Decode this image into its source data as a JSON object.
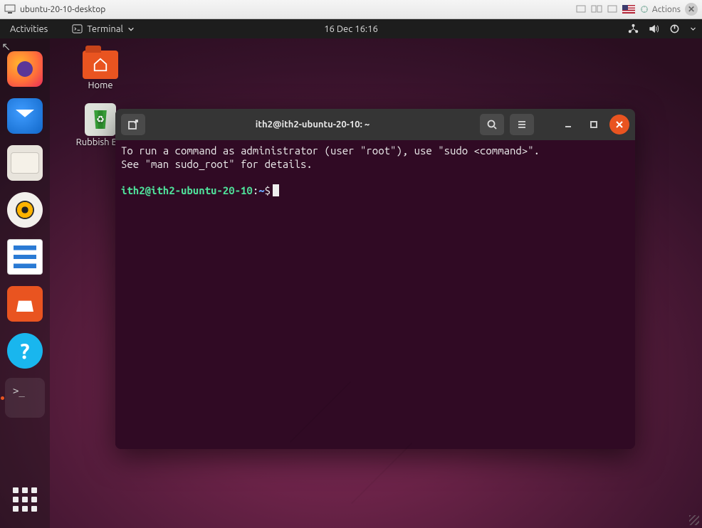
{
  "vm": {
    "title": "ubuntu-20-10-desktop",
    "actions_label": "Actions"
  },
  "topbar": {
    "activities": "Activities",
    "app_menu": "Terminal",
    "clock": "16 Dec  16:16"
  },
  "dock": {
    "items": [
      {
        "name": "firefox",
        "label": "Firefox"
      },
      {
        "name": "thunderbird",
        "label": "Thunderbird"
      },
      {
        "name": "files",
        "label": "Files"
      },
      {
        "name": "rhythmbox",
        "label": "Rhythmbox"
      },
      {
        "name": "writer",
        "label": "LibreOffice Writer"
      },
      {
        "name": "software",
        "label": "Ubuntu Software"
      },
      {
        "name": "help",
        "label": "Help"
      },
      {
        "name": "terminal",
        "label": "Terminal",
        "running": true
      }
    ]
  },
  "desktop": {
    "icons": [
      {
        "id": "home",
        "label": "Home"
      },
      {
        "id": "trash",
        "label": "Rubbish Bin"
      }
    ]
  },
  "terminal": {
    "title": "ith2@ith2-ubuntu-20-10: ~",
    "motd_line1": "To run a command as administrator (user \"root\"), use \"sudo <command>\".",
    "motd_line2": "See \"man sudo_root\" for details.",
    "prompt": {
      "userhost": "ith2@ith2-ubuntu-20-10",
      "sep": ":",
      "path": "~",
      "symbol": "$"
    }
  }
}
